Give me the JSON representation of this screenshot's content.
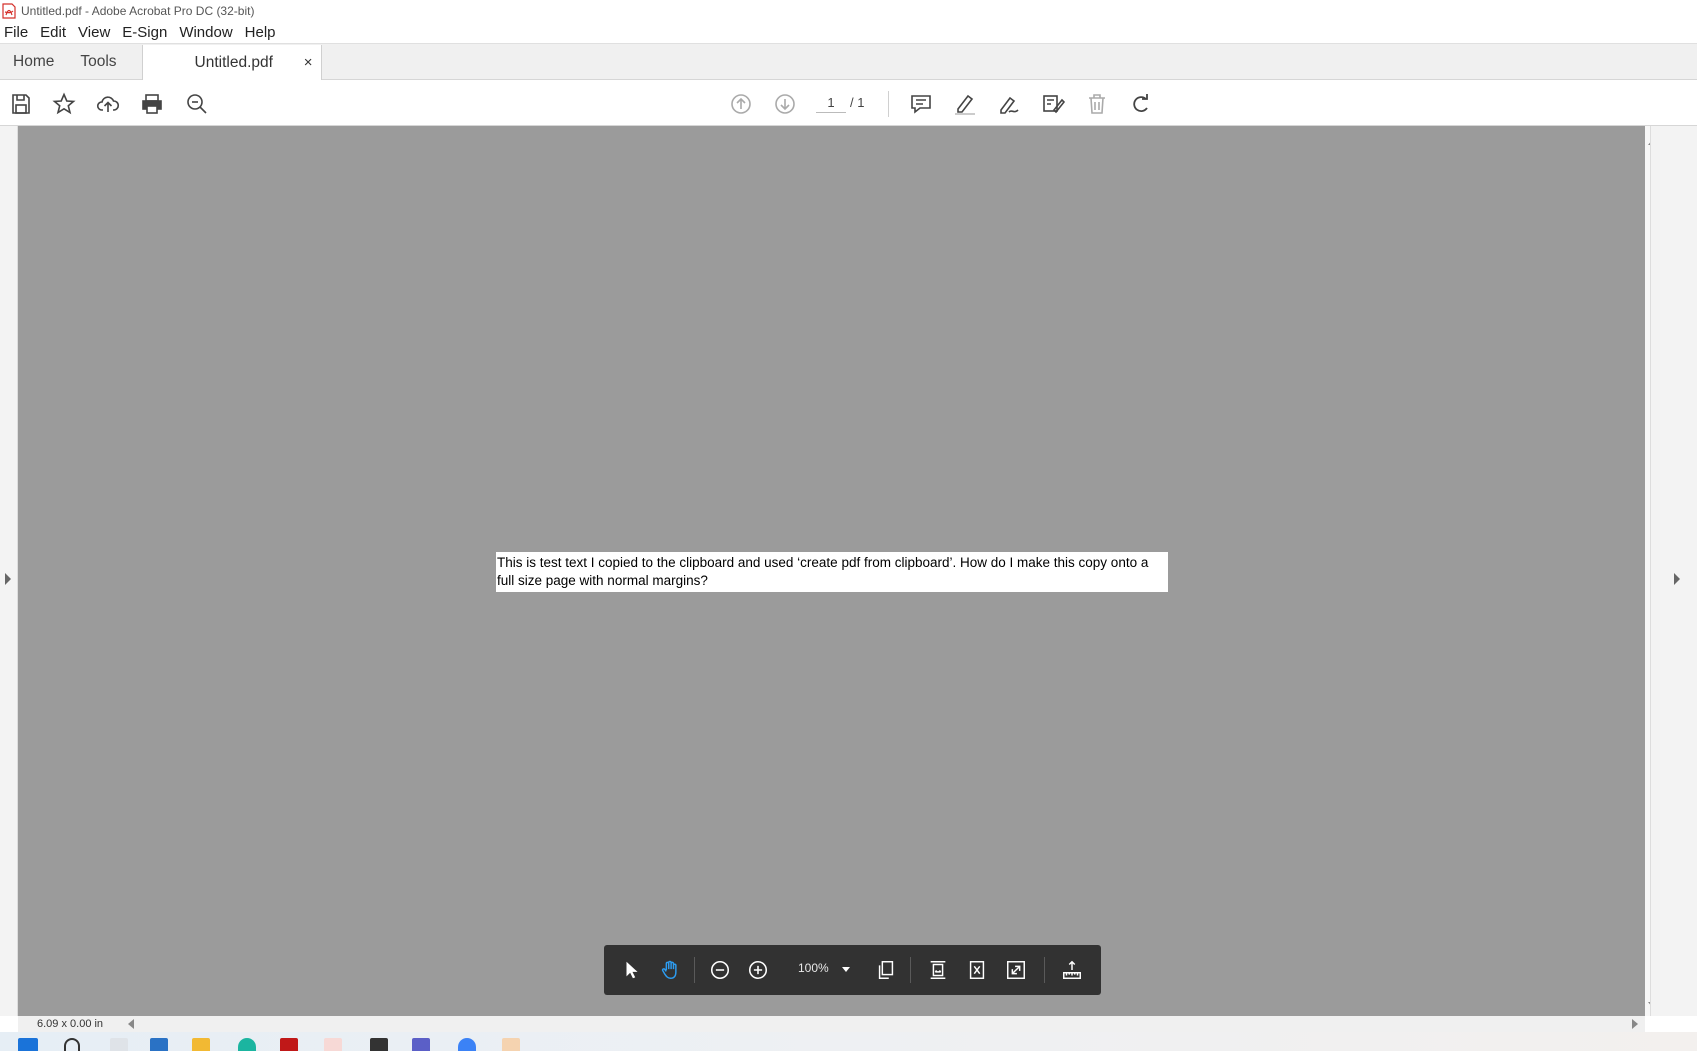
{
  "window": {
    "title": "Untitled.pdf - Adobe Acrobat Pro DC (32-bit)"
  },
  "menu": [
    "File",
    "Edit",
    "View",
    "E-Sign",
    "Window",
    "Help"
  ],
  "tabs": {
    "home": "Home",
    "tools": "Tools",
    "document": "Untitled.pdf",
    "close_glyph": "×"
  },
  "toolbar": {
    "left_icons": [
      "save-icon",
      "star-icon",
      "cloud-upload-icon",
      "print-icon",
      "search-zoom-icon"
    ],
    "page_current": "1",
    "page_total": "/ 1",
    "right_icons": [
      "comment-icon",
      "highlight-pen-icon",
      "sign-icon",
      "edit-tool-icon",
      "delete-icon",
      "rotate-icon"
    ]
  },
  "document": {
    "text": "This is test text I copied to the clipboard and used ‘create pdf from clipboard’. How do I make this copy onto a full size page with normal margins?"
  },
  "statusbar": {
    "dimensions": "6.09 x 0.00 in"
  },
  "floating_toolbar": {
    "zoom": "100%",
    "icons": [
      "select-arrow-icon",
      "hand-icon",
      "zoom-out-icon",
      "zoom-in-icon",
      "zoom-dropdown-icon",
      "single-page-icon",
      "fit-width-icon",
      "fit-page-icon",
      "full-screen-icon",
      "measure-icon"
    ]
  },
  "colors": {
    "canvas": "#9b9b9b",
    "accent": "#1473e6",
    "floatbar": "#323232"
  }
}
